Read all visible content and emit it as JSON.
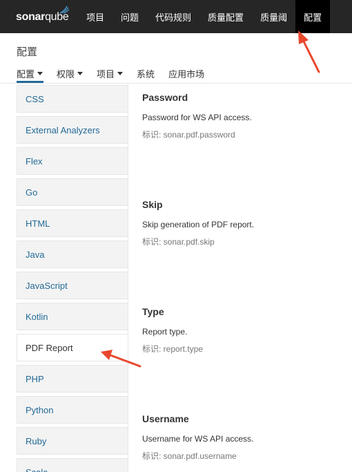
{
  "topbar": {
    "logo_part1": "sonar",
    "logo_part2": "qube",
    "nav": [
      {
        "label": "项目"
      },
      {
        "label": "问题"
      },
      {
        "label": "代码规则"
      },
      {
        "label": "质量配置"
      },
      {
        "label": "质量阈"
      },
      {
        "label": "配置"
      }
    ],
    "active_index": 5
  },
  "page": {
    "title": "配置",
    "subnav": [
      {
        "label": "配置",
        "dropdown": true
      },
      {
        "label": "权限",
        "dropdown": true
      },
      {
        "label": "项目",
        "dropdown": true
      },
      {
        "label": "系统",
        "dropdown": false
      },
      {
        "label": "应用市场",
        "dropdown": false
      }
    ]
  },
  "sidebar": {
    "categories": [
      {
        "label": "CSS"
      },
      {
        "label": "External Analyzers"
      },
      {
        "label": "Flex"
      },
      {
        "label": "Go"
      },
      {
        "label": "HTML"
      },
      {
        "label": "Java"
      },
      {
        "label": "JavaScript"
      },
      {
        "label": "Kotlin"
      },
      {
        "label": "PDF Report"
      },
      {
        "label": "PHP"
      },
      {
        "label": "Python"
      },
      {
        "label": "Ruby"
      },
      {
        "label": "Scala"
      }
    ],
    "selected": "PDF Report"
  },
  "settings": [
    {
      "title": "Password",
      "description": "Password for WS API access.",
      "key": "标识: sonar.pdf.password"
    },
    {
      "title": "Skip",
      "description": "Skip generation of PDF report.",
      "key": "标识: sonar.pdf.skip"
    },
    {
      "title": "Type",
      "description": "Report type.",
      "key": "标识: report.type"
    },
    {
      "title": "Username",
      "description": "Username for WS API access.",
      "key": "标识: sonar.pdf.username"
    }
  ],
  "colors": {
    "topbar": "#262626",
    "link": "#236a97",
    "annotation": "#e8472d"
  }
}
